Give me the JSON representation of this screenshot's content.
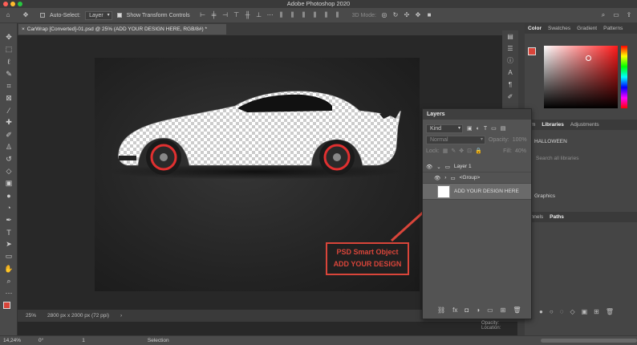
{
  "app": {
    "title": "Adobe Photoshop 2020"
  },
  "options_bar": {
    "auto_select_label": "Auto-Select:",
    "auto_select_value": "Layer",
    "show_transform_label": "Show Transform Controls",
    "mode_3d_label": "3D Mode:"
  },
  "document": {
    "tab_title": "CarWrap [Converted]-01.psd @ 25% (ADD YOUR DESIGN HERE, RGB/8#) *",
    "zoom": "25%",
    "doc_info": "2800 px x 2000 px (72 ppi)"
  },
  "callout": {
    "line1": "PSD Smart Object",
    "line2": "ADD YOUR DESIGN",
    "color": "#d9453a"
  },
  "layers_panel": {
    "title": "Layers",
    "filter_kind": "Kind",
    "blend_mode": "Normal",
    "opacity_label": "Opacity:",
    "opacity_value": "100%",
    "lock_label": "Lock:",
    "fill_label": "Fill:",
    "fill_value": "40%",
    "rows": [
      {
        "name": "Layer 1",
        "type": "folder"
      },
      {
        "name": "<Group>",
        "type": "folder"
      },
      {
        "name": "ADD YOUR DESIGN HERE",
        "type": "smart-object"
      }
    ]
  },
  "right_panels": {
    "color_tabs": [
      "Color",
      "Swatches",
      "Gradient",
      "Patterns"
    ],
    "lib_tabs": [
      "arn",
      "Libraries",
      "Adjustments"
    ],
    "library_name": "HALLOWEEN",
    "search_placeholder": "Search all libraries",
    "graphics_label": "Graphics",
    "path_tabs": [
      "annels",
      "Paths"
    ],
    "opacity_label": "Opacity:",
    "location_label": "Location:"
  },
  "bottom_bar": {
    "zoom": "14,24%",
    "angle": "0°",
    "value": "1",
    "mode": "Selection"
  },
  "colors": {
    "foreground": "#d9453a",
    "brand_red": "#d9453a"
  }
}
